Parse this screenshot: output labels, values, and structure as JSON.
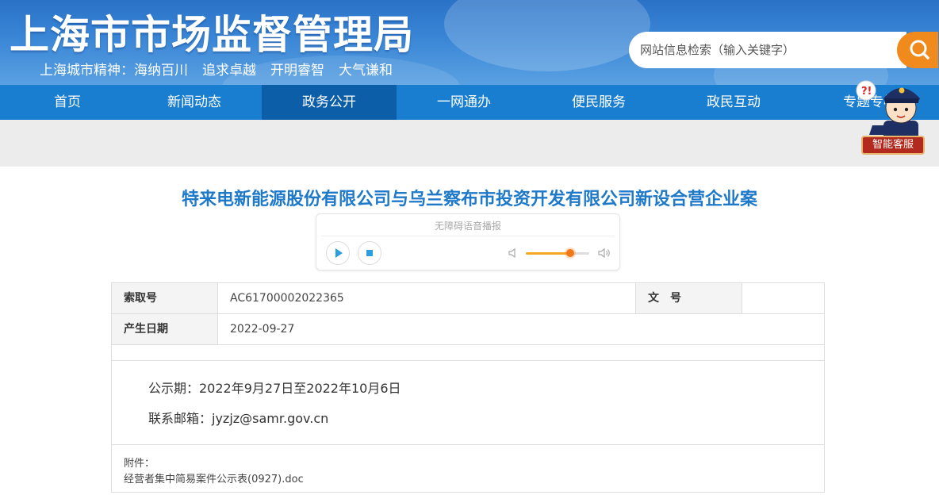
{
  "header": {
    "site_title": "上海市市场监督管理局",
    "spirit": [
      "上海城市精神：海纳百川",
      "追求卓越",
      "开明睿智",
      "大气谦和"
    ],
    "search_placeholder": "网站信息检索（输入关键字）"
  },
  "nav": {
    "items": [
      "首页",
      "新闻动态",
      "政务公开",
      "一网通办",
      "便民服务",
      "政民互动",
      "专题专栏"
    ],
    "active_index": 2
  },
  "customer_service": {
    "label": "智能客服"
  },
  "document": {
    "title": "特来电新能源股份有限公司与乌兰察布市投资开发有限公司新设合营企业案"
  },
  "player": {
    "title": "无障碍语音播报",
    "volume_level": 0.7
  },
  "info_table": {
    "index_label": "索取号",
    "index_value": "AC61700002022365",
    "doc_no_label": "文　号",
    "doc_no_value": "",
    "date_label": "产生日期",
    "date_value": "2022-09-27"
  },
  "content": {
    "notice_period": "公示期：2022年9月27日至2022年10月6日",
    "email": "联系邮箱：jyzjz@samr.gov.cn"
  },
  "attachment": {
    "label": "附件：",
    "file": "经营者集中简易案件公示表(0927).doc"
  },
  "colors": {
    "banner": "#2a72c7",
    "nav": "#1a7ed0",
    "nav_active": "#0d5ea8",
    "search_button": "#f08a1c",
    "title": "#1f79c9"
  }
}
